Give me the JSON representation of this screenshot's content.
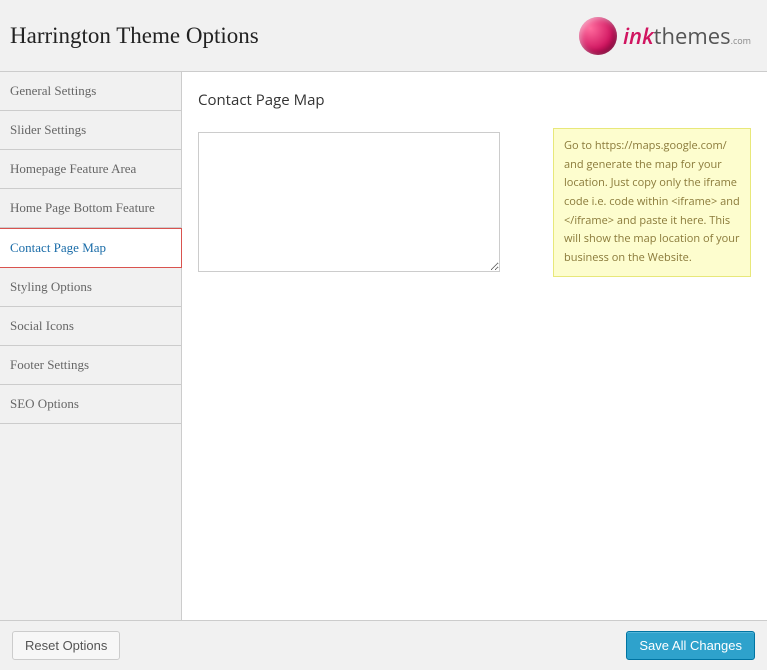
{
  "header": {
    "title": "Harrington Theme Options",
    "logo_ink": "ink",
    "logo_themes": "themes",
    "logo_com": ".com"
  },
  "sidebar": {
    "items": [
      {
        "label": "General Settings",
        "active": false
      },
      {
        "label": "Slider Settings",
        "active": false
      },
      {
        "label": "Homepage Feature Area",
        "active": false
      },
      {
        "label": "Home Page Bottom Feature",
        "active": false
      },
      {
        "label": "Contact Page Map",
        "active": true
      },
      {
        "label": "Styling Options",
        "active": false
      },
      {
        "label": "Social Icons",
        "active": false
      },
      {
        "label": "Footer Settings",
        "active": false
      },
      {
        "label": "SEO Options",
        "active": false
      }
    ]
  },
  "main": {
    "section_title": "Contact Page Map",
    "textarea_value": "",
    "help_text": "Go to https://maps.google.com/ and generate the map for your location. Just copy only the iframe code i.e. code within <iframe> and </iframe> and paste it here. This will show the map location of your business on the Website."
  },
  "footer": {
    "reset_label": "Reset Options",
    "save_label": "Save All Changes"
  }
}
